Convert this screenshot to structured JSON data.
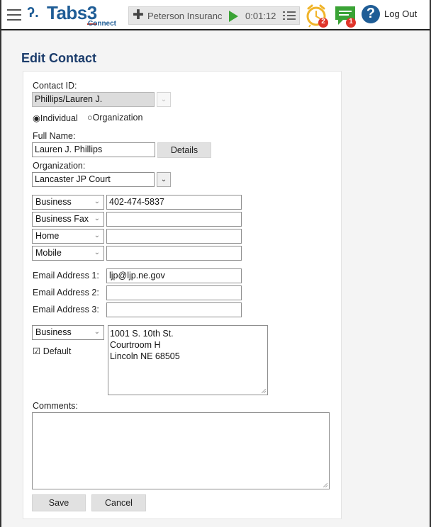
{
  "app": {
    "logo_text": "Tabs",
    "logo_number": "3",
    "logo_sub": "Connect",
    "logout_label": "Log Out",
    "colors": {
      "brand": "#1f5d96",
      "play": "#3aa335",
      "chat": "#3aa335",
      "help": "#1f5d96",
      "badge": "#e0352b",
      "clock": "#f0b42a"
    }
  },
  "timer": {
    "client": "Peterson Insuranc",
    "elapsed": "0:01:12",
    "icons": {
      "add": "plus-icon",
      "play": "play-icon",
      "list": "list-icon"
    }
  },
  "notifications": {
    "reminders_count": "2",
    "messages_count": "1",
    "help_glyph": "?"
  },
  "page": {
    "title": "Edit Contact"
  },
  "form": {
    "contact_id_label": "Contact ID:",
    "contact_id_value": "Phillips/Lauren J.",
    "radio_individual": "Individual",
    "radio_organization": "Organization",
    "selected_type": "Individual",
    "full_name_label": "Full Name:",
    "full_name_value": "Lauren J. Phillips",
    "details_button": "Details",
    "organization_label": "Organization:",
    "organization_value": "Lancaster JP Court",
    "phones": [
      {
        "type": "Business",
        "number": "402-474-5837"
      },
      {
        "type": "Business Fax",
        "number": ""
      },
      {
        "type": "Home",
        "number": ""
      },
      {
        "type": "Mobile",
        "number": ""
      }
    ],
    "emails": [
      {
        "label": "Email Address 1:",
        "value": "ljp@ljp.ne.gov"
      },
      {
        "label": "Email Address 2:",
        "value": ""
      },
      {
        "label": "Email Address 3:",
        "value": ""
      }
    ],
    "address_type": "Business",
    "default_label": "Default",
    "default_checked": true,
    "address_lines": [
      "1001 S. 10th St.",
      "Courtroom H",
      "Lincoln NE  68505"
    ],
    "comments_label": "Comments:",
    "comments_value": "",
    "save_button": "Save",
    "cancel_button": "Cancel"
  }
}
